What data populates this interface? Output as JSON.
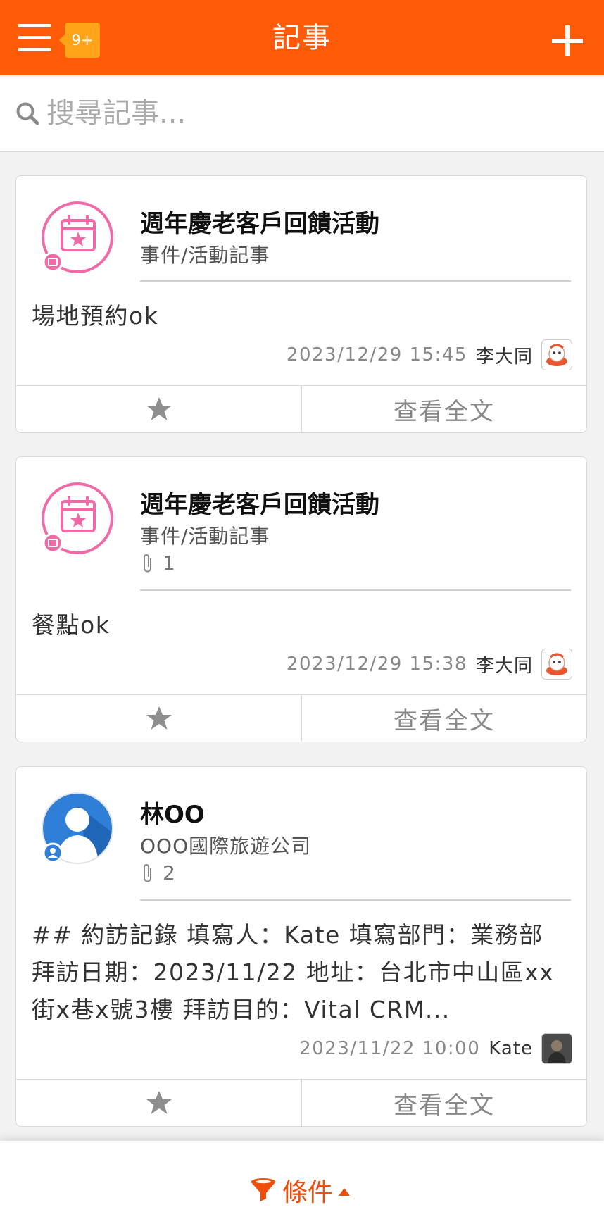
{
  "header": {
    "title": "記事",
    "badge": "9+"
  },
  "search": {
    "placeholder": "搜尋記事..."
  },
  "notes": [
    {
      "title": "週年慶老客戶回饋活動",
      "category": "事件/活動記事",
      "attachments": "",
      "body": "場地預約ok",
      "datetime": "2023/12/29 15:45",
      "author": "李大同",
      "view_label": "查看全文"
    },
    {
      "title": "週年慶老客戶回饋活動",
      "category": "事件/活動記事",
      "attachments": "1",
      "body": "餐點ok",
      "datetime": "2023/12/29 15:38",
      "author": "李大同",
      "view_label": "查看全文"
    },
    {
      "title": "林OO",
      "category": "OOO國際旅遊公司",
      "attachments": "2",
      "body": "## 約訪記錄 填寫人：Kate 填寫部門：業務部 拜訪日期：2023/11/22 地址：台北市中山區xx街x巷x號3樓 拜訪目的：Vital CRM...",
      "datetime": "2023/11/22 10:00",
      "author": "Kate",
      "view_label": "查看全文"
    }
  ],
  "footer": {
    "filter_label": "條件"
  },
  "colors": {
    "brand_orange": "#fe5a07",
    "badge_yellow": "#ffa319",
    "event_pink": "#f06aa8",
    "contact_blue": "#2f7fd6",
    "filter_orange": "#ef4d0a"
  }
}
